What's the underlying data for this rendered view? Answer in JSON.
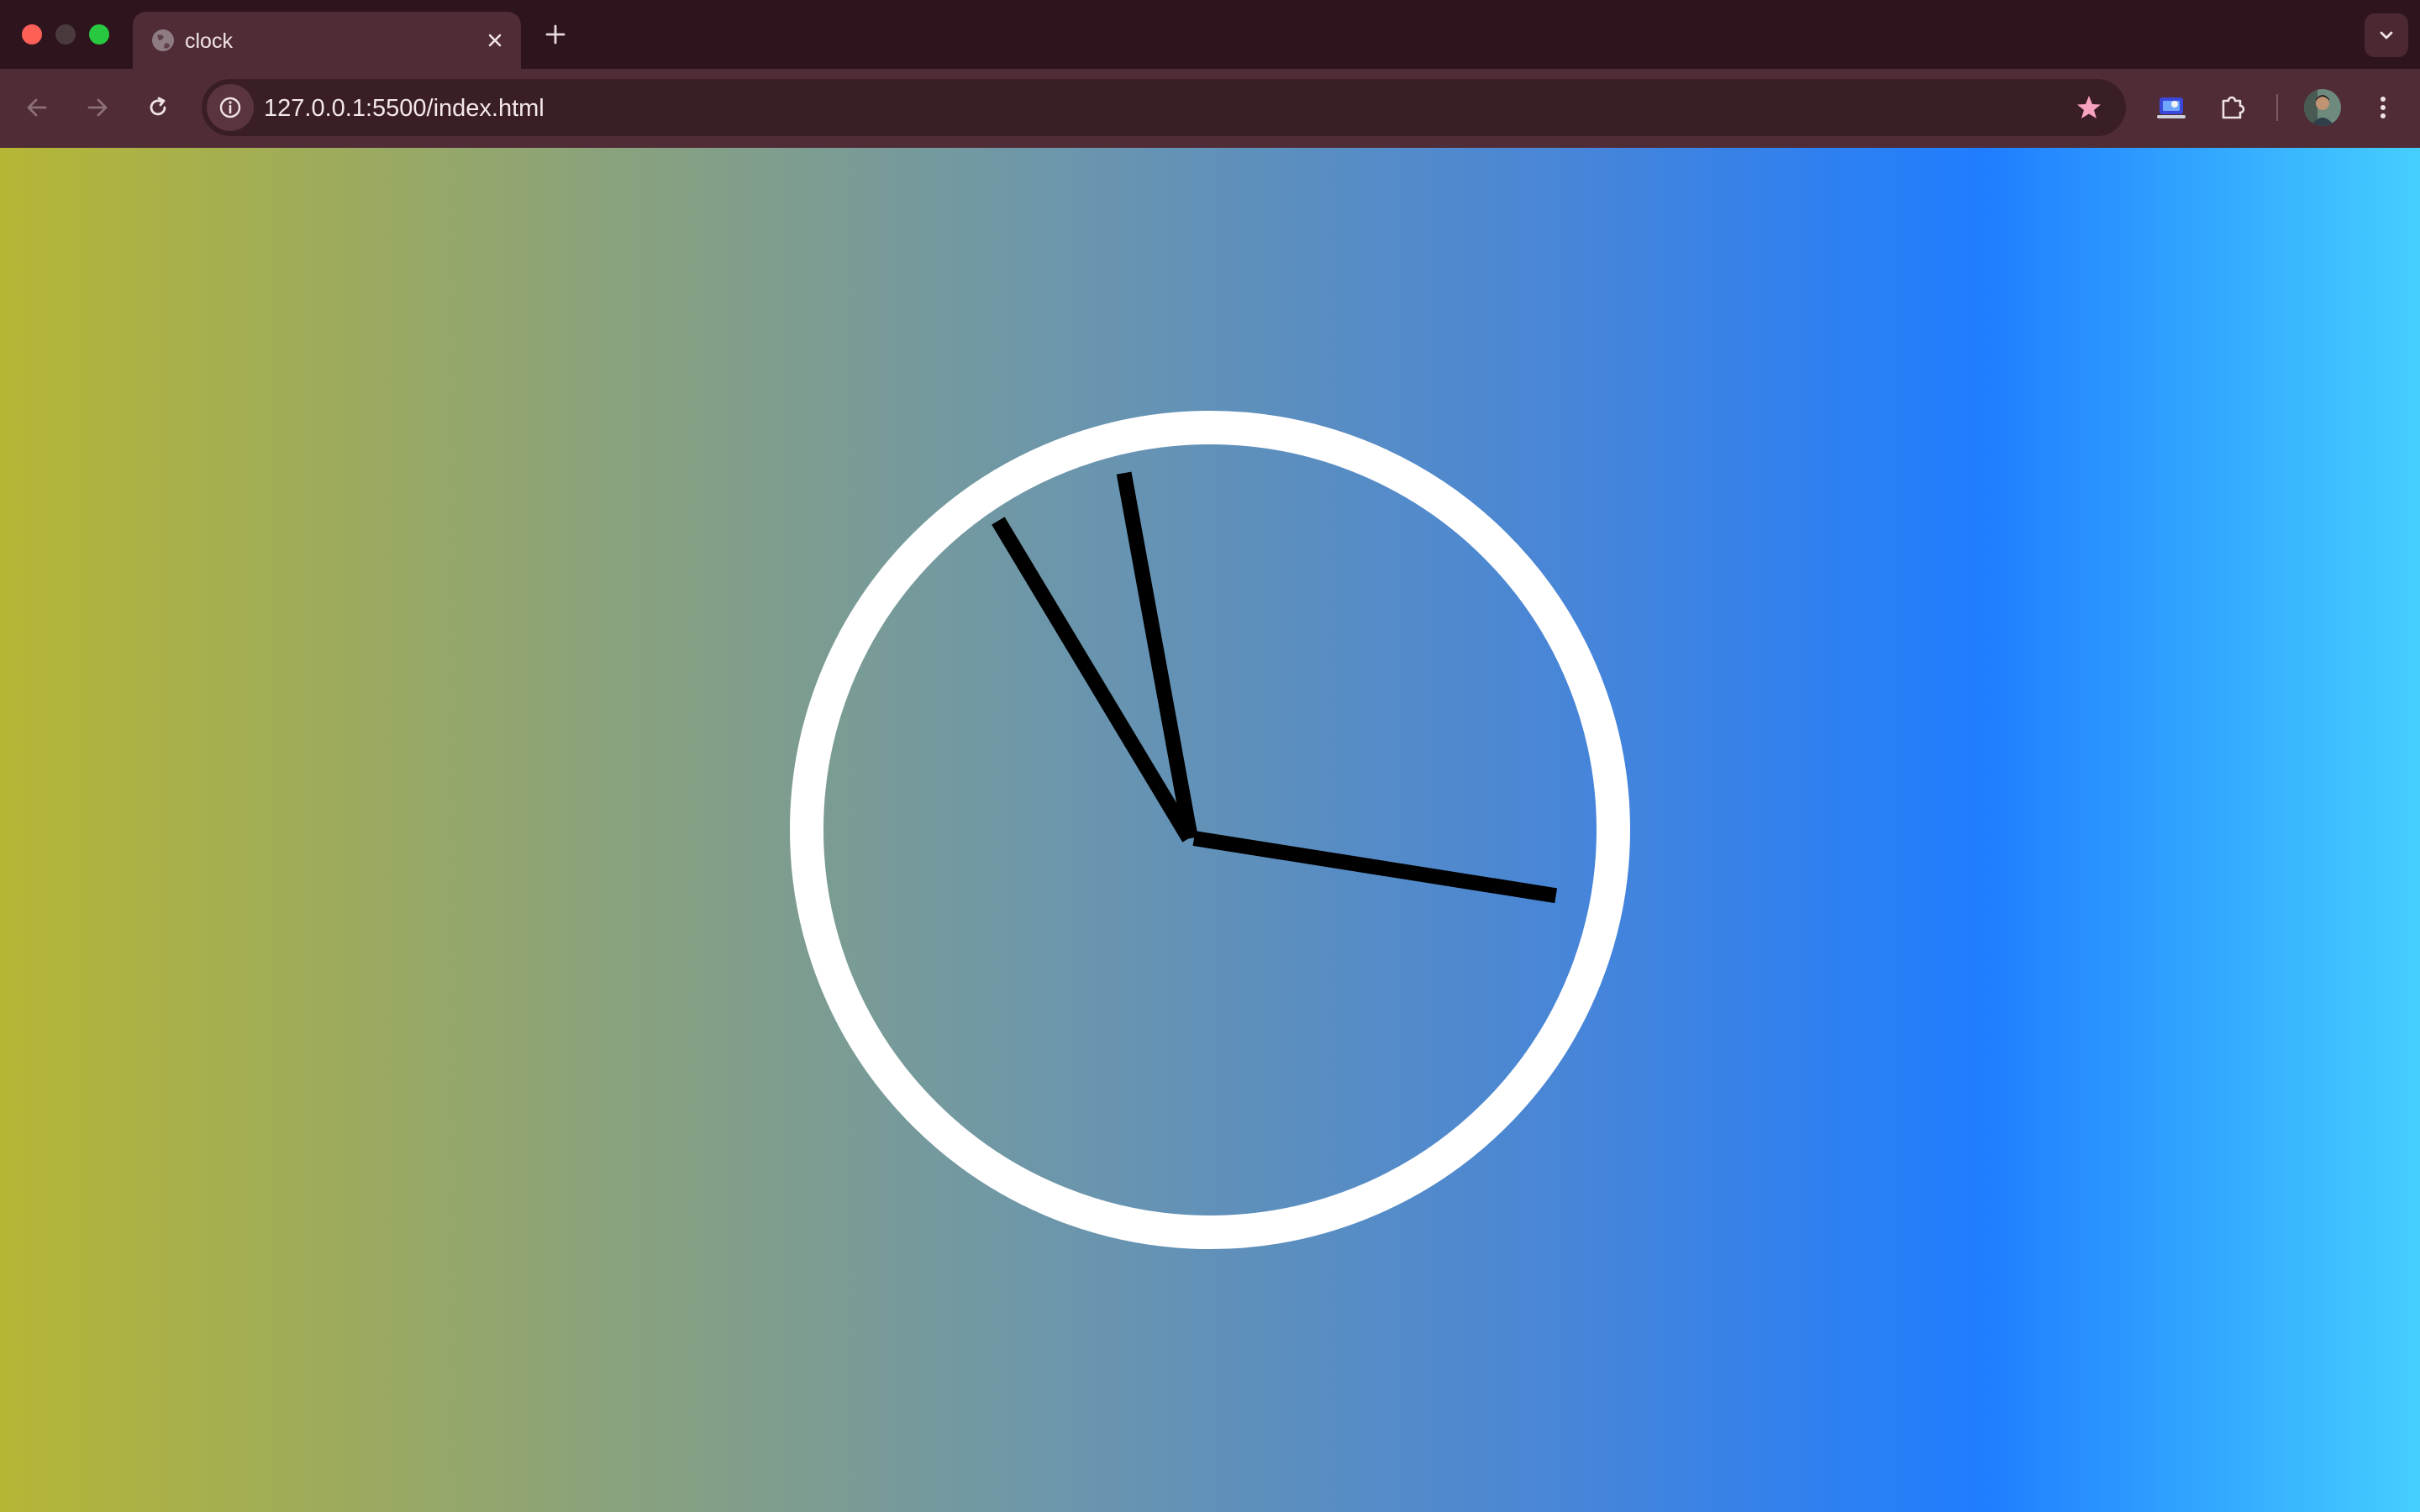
{
  "window": {
    "controls": [
      "close",
      "minimize",
      "maximize"
    ]
  },
  "tabs": [
    {
      "title": "clock",
      "icon": "globe-icon",
      "active": true
    }
  ],
  "toolbar": {
    "url": "127.0.0.1:5500/index.html",
    "back_icon": "arrow-left-icon",
    "forward_icon": "arrow-right-icon",
    "reload_icon": "reload-icon",
    "bookmark_icon": "star-icon",
    "extensions": [
      "screen-share-icon",
      "puzzle-icon"
    ],
    "menu_icon": "kebab-menu-icon"
  },
  "colors": {
    "gradient": [
      "#b5b635",
      "#8aa27c",
      "#6a95ae",
      "#4785d8",
      "#1f7dff",
      "#45cfff"
    ],
    "clock_ring": "#ffffff",
    "hands": "#000000",
    "bookmark_star": "#f7a3c0"
  },
  "clock": {
    "time": {
      "hours": 10,
      "minutes": 58,
      "seconds": 16.5
    }
  }
}
